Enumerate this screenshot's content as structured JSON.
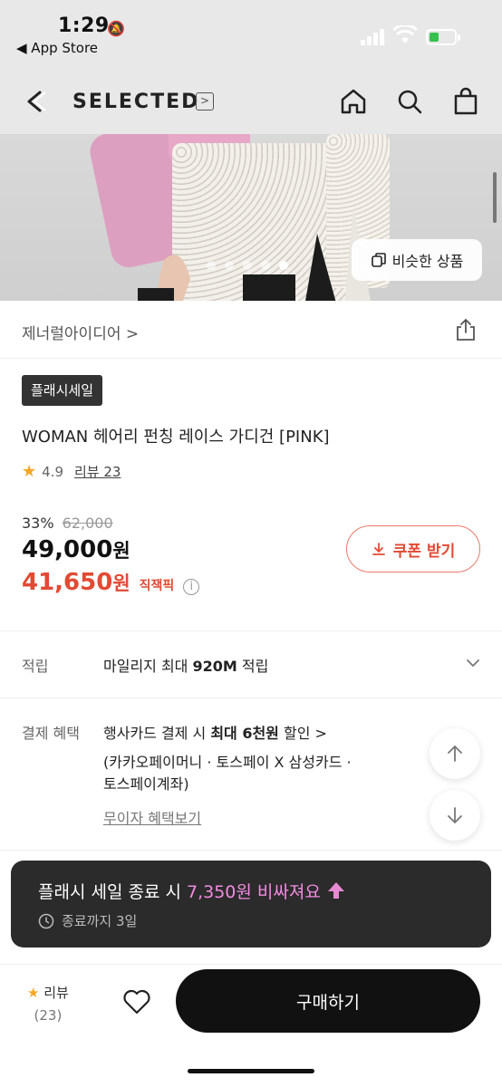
{
  "status": {
    "time": "1:29",
    "back_app": "◀ App Store"
  },
  "nav": {
    "brand": "SELECTED",
    "brand_arrow": ">"
  },
  "hero": {
    "similar_label": "비슷한 상품",
    "dot_count": 5,
    "active_dot": 5
  },
  "store": {
    "name": "제너럴아이디어 >"
  },
  "product": {
    "badge": "플래시세일",
    "title": "WOMAN 헤어리 펀칭 레이스 가디건 [PINK]",
    "rating": "4.9",
    "review_link": "리뷰 23",
    "discount_rate": "33%",
    "original_price": "62,000",
    "price": "49,000",
    "price_unit": "원",
    "direct_price": "41,650",
    "direct_unit": "원",
    "direct_label": "직잭픽",
    "coupon_label": "쿠폰 받기"
  },
  "points": {
    "label": "적립",
    "value_prefix": "마일리지 최대 ",
    "value_bold": "920M",
    "value_suffix": " 적립"
  },
  "payment": {
    "label": "결제 혜택",
    "line1_prefix": "행사카드 결제 시 ",
    "line1_bold": "최대 6천원",
    "line1_suffix": " 할인 >",
    "line2": "(카카오페이머니 · 토스페이 X 삼성카드 ·",
    "line3": "토스페이계좌)",
    "link": "무이자 혜택보기"
  },
  "toast": {
    "prefix": "플래시 세일 종료 시 ",
    "highlight": "7,350원 비싸져요",
    "remaining": "종료까지 3일"
  },
  "bottom": {
    "review_label": "리뷰",
    "review_count": "(23)",
    "buy_label": "구매하기"
  },
  "colors": {
    "accent_red": "#e24a33",
    "toast_pink": "#f28be0",
    "star": "#f5a623"
  }
}
